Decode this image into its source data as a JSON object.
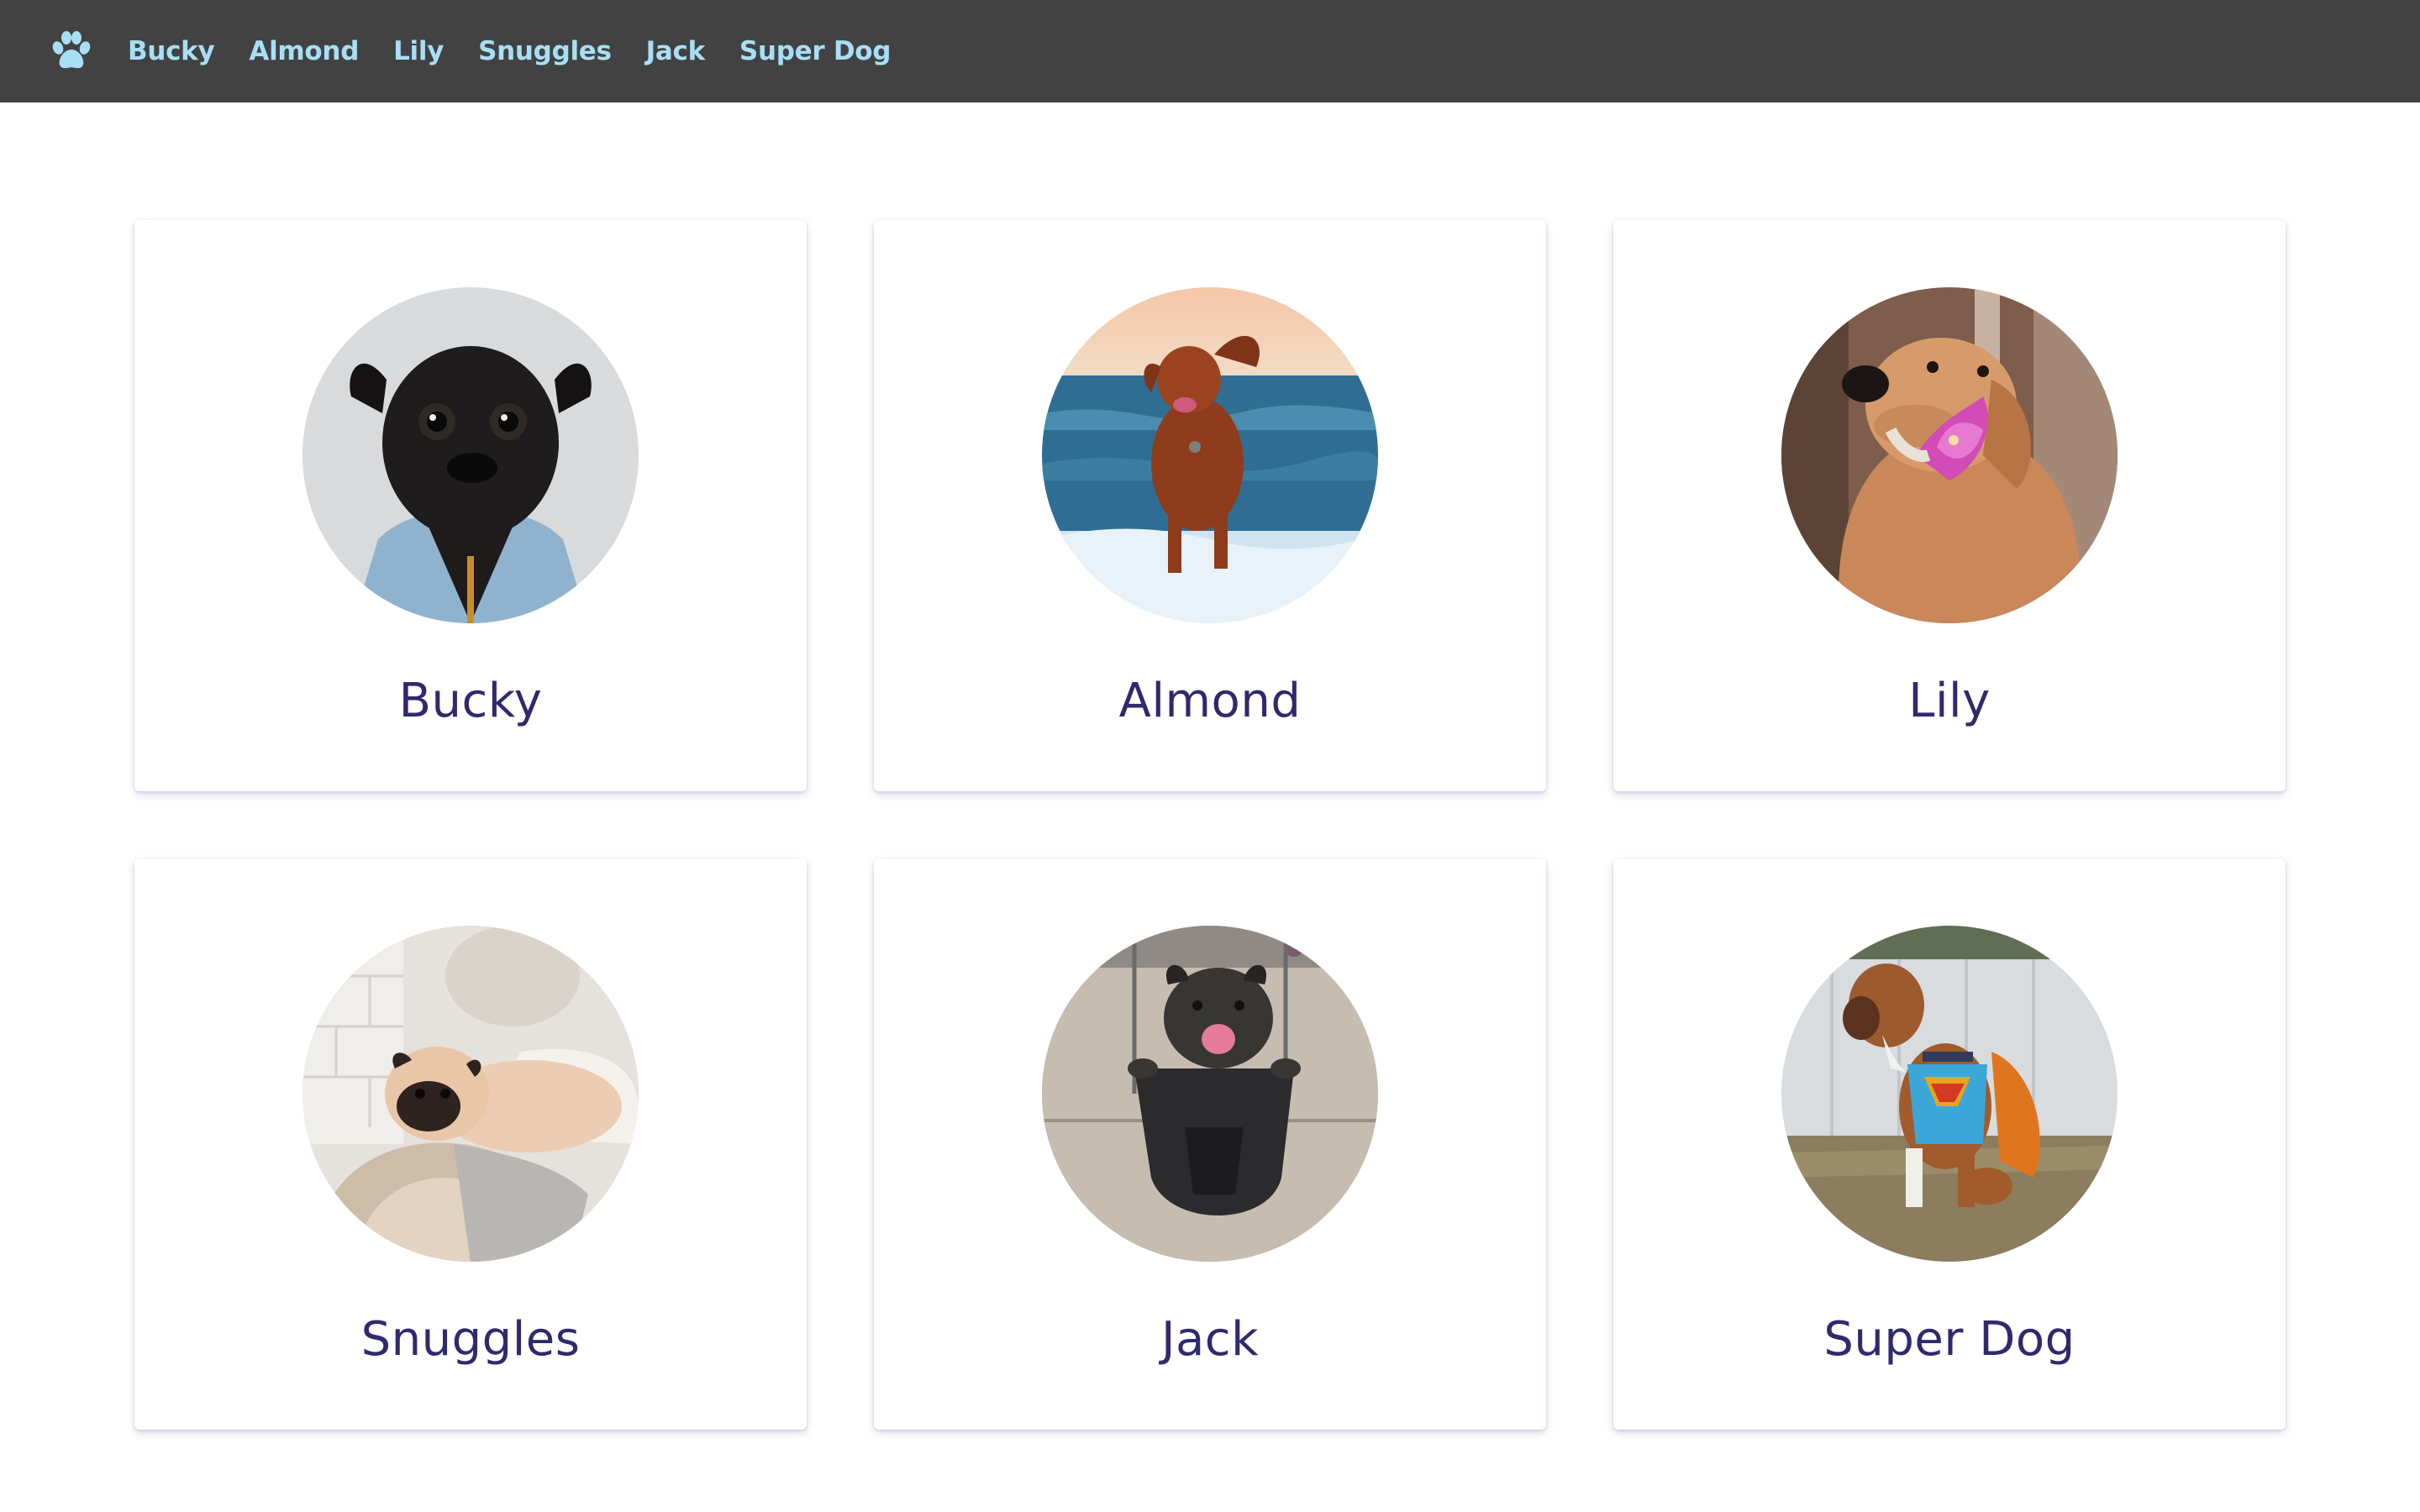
{
  "navbar": {
    "brand_icon": "paw-icon",
    "links": [
      {
        "label": "Bucky"
      },
      {
        "label": "Almond"
      },
      {
        "label": "Lily"
      },
      {
        "label": "Snuggles"
      },
      {
        "label": "Jack"
      },
      {
        "label": "Super Dog"
      }
    ]
  },
  "dogs": [
    {
      "name": "Bucky"
    },
    {
      "name": "Almond"
    },
    {
      "name": "Lily"
    },
    {
      "name": "Snuggles"
    },
    {
      "name": "Jack"
    },
    {
      "name": "Super Dog"
    }
  ],
  "colors": {
    "navbar_bg": "#424242",
    "nav_link": "#a8dff5",
    "dog_name": "#2f2a6e"
  }
}
